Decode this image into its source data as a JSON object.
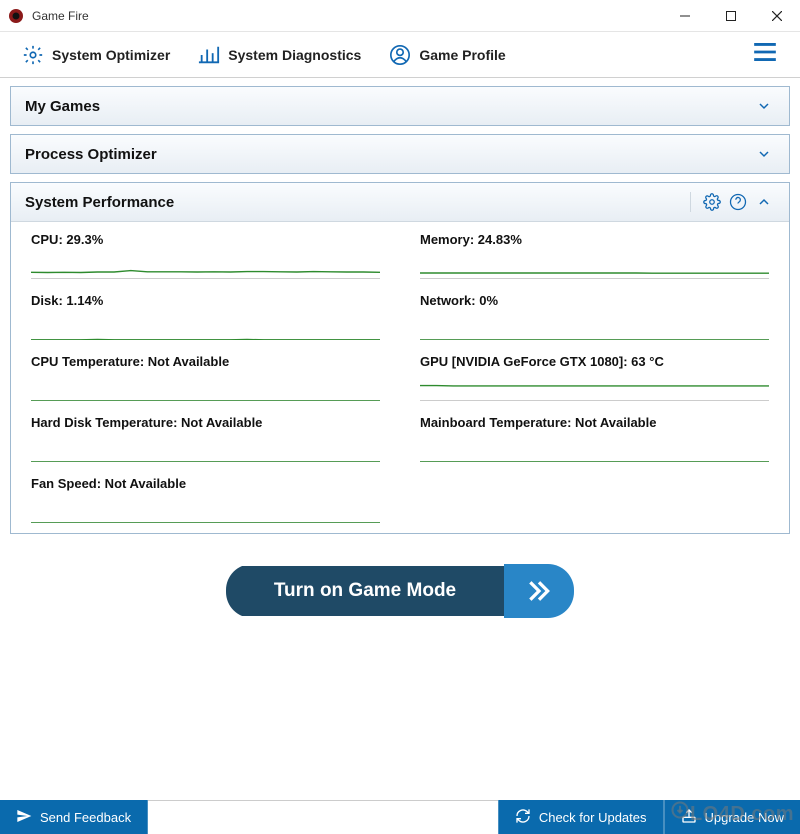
{
  "window": {
    "title": "Game Fire"
  },
  "toolbar": {
    "system_optimizer": "System Optimizer",
    "system_diagnostics": "System Diagnostics",
    "game_profile": "Game Profile"
  },
  "panels": {
    "my_games": {
      "title": "My Games",
      "expanded": false
    },
    "process_optimizer": {
      "title": "Process Optimizer",
      "expanded": false
    },
    "system_performance": {
      "title": "System Performance",
      "expanded": true
    }
  },
  "stats": {
    "cpu": {
      "label": "CPU: 29.3%"
    },
    "memory": {
      "label": "Memory: 24.83%"
    },
    "disk": {
      "label": "Disk: 1.14%"
    },
    "network": {
      "label": "Network: 0%"
    },
    "cpu_temp": {
      "label": "CPU Temperature: Not Available"
    },
    "gpu": {
      "label": "GPU [NVIDIA GeForce GTX 1080]: 63 °C"
    },
    "hdd_temp": {
      "label": "Hard Disk Temperature: Not Available"
    },
    "mb_temp": {
      "label": "Mainboard Temperature: Not Available"
    },
    "fan": {
      "label": "Fan Speed: Not Available"
    }
  },
  "cta": {
    "label": "Turn on Game Mode"
  },
  "footer": {
    "send_feedback": "Send Feedback",
    "check_updates": "Check for Updates",
    "upgrade": "Upgrade Now"
  },
  "chart_data": [
    {
      "name": "cpu",
      "type": "line",
      "ylim": [
        0,
        100
      ],
      "values": [
        28,
        27,
        28,
        27,
        29,
        29,
        35,
        30,
        30,
        30,
        29,
        30,
        29,
        31,
        31,
        30,
        29,
        31,
        30,
        29,
        29,
        28
      ]
    },
    {
      "name": "memory",
      "type": "line",
      "ylim": [
        0,
        100
      ],
      "values": [
        25,
        25,
        25,
        25,
        25,
        25,
        25,
        25,
        25,
        25,
        25,
        25,
        25,
        25,
        24,
        24,
        24,
        24,
        24,
        24,
        24,
        24
      ]
    },
    {
      "name": "disk",
      "type": "line",
      "ylim": [
        0,
        100
      ],
      "values": [
        1,
        1,
        1,
        1,
        2,
        1,
        1,
        1,
        1,
        1,
        1,
        1,
        1,
        2,
        1,
        1,
        1,
        1,
        1,
        1,
        1,
        1
      ]
    },
    {
      "name": "network",
      "type": "line",
      "ylim": [
        0,
        100
      ],
      "values": [
        0,
        0,
        0,
        0,
        0,
        0,
        0,
        0,
        0,
        0,
        0,
        0,
        0,
        0,
        0,
        0,
        0,
        0,
        0,
        0,
        0,
        0
      ]
    },
    {
      "name": "cpu_temp",
      "type": "line",
      "ylim": [
        0,
        100
      ],
      "values": [
        0,
        0,
        0,
        0,
        0,
        0,
        0,
        0,
        0,
        0,
        0,
        0,
        0,
        0,
        0,
        0,
        0,
        0,
        0,
        0,
        0,
        0
      ]
    },
    {
      "name": "gpu",
      "type": "line",
      "ylim": [
        0,
        100
      ],
      "values": [
        64,
        64,
        63,
        63,
        63,
        63,
        63,
        63,
        63,
        63,
        63,
        63,
        63,
        63,
        63,
        63,
        63,
        63,
        63,
        63,
        63,
        63
      ]
    },
    {
      "name": "hdd_temp",
      "type": "line",
      "ylim": [
        0,
        100
      ],
      "values": [
        0,
        0,
        0,
        0,
        0,
        0,
        0,
        0,
        0,
        0,
        0,
        0,
        0,
        0,
        0,
        0,
        0,
        0,
        0,
        0,
        0,
        0
      ]
    },
    {
      "name": "mb_temp",
      "type": "line",
      "ylim": [
        0,
        100
      ],
      "values": [
        0,
        0,
        0,
        0,
        0,
        0,
        0,
        0,
        0,
        0,
        0,
        0,
        0,
        0,
        0,
        0,
        0,
        0,
        0,
        0,
        0,
        0
      ]
    },
    {
      "name": "fan",
      "type": "line",
      "ylim": [
        0,
        100
      ],
      "values": [
        0,
        0,
        0,
        0,
        0,
        0,
        0,
        0,
        0,
        0,
        0,
        0,
        0,
        0,
        0,
        0,
        0,
        0,
        0,
        0,
        0,
        0
      ]
    }
  ],
  "colors": {
    "accent": "#1168b3",
    "chart_stroke": "#2e8b2e",
    "footer_bg": "#0a6aad",
    "cta_dark": "#1f4a66",
    "cta_light": "#2986c7"
  },
  "watermark": "LO4D.com"
}
